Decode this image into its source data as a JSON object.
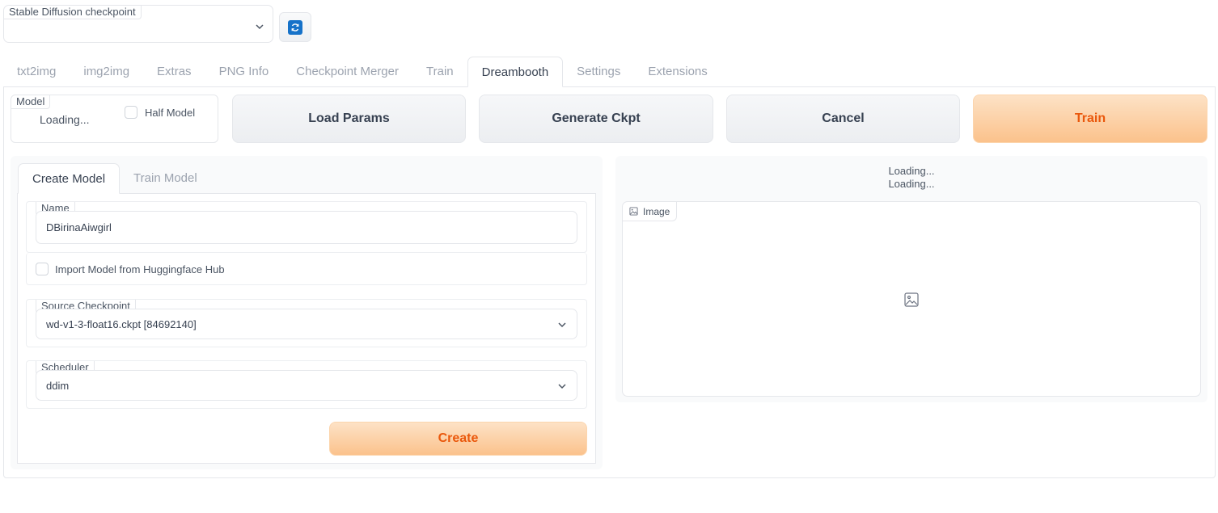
{
  "checkpoint": {
    "label": "Stable Diffusion checkpoint",
    "value": "",
    "refresh_icon": "refresh-icon"
  },
  "tabs": [
    {
      "label": "txt2img"
    },
    {
      "label": "img2img"
    },
    {
      "label": "Extras"
    },
    {
      "label": "PNG Info"
    },
    {
      "label": "Checkpoint Merger"
    },
    {
      "label": "Train"
    },
    {
      "label": "Dreambooth",
      "active": true
    },
    {
      "label": "Settings"
    },
    {
      "label": "Extensions"
    }
  ],
  "model": {
    "label": "Model",
    "loading": "Loading...",
    "half_model_label": "Half Model",
    "half_model_checked": false
  },
  "actions": {
    "load_params": "Load Params",
    "generate_ckpt": "Generate Ckpt",
    "cancel": "Cancel",
    "train": "Train"
  },
  "subtabs": [
    {
      "label": "Create Model",
      "active": true
    },
    {
      "label": "Train Model"
    }
  ],
  "create": {
    "name_label": "Name",
    "name_value": "DBirinaAiwgirl",
    "import_label": "Import Model from Huggingface Hub",
    "import_checked": false,
    "source_label": "Source Checkpoint",
    "source_value": "wd-v1-3-float16.ckpt [84692140]",
    "scheduler_label": "Scheduler",
    "scheduler_value": "ddim",
    "create_button": "Create"
  },
  "output": {
    "loading_1": "Loading...",
    "loading_2": "Loading...",
    "image_label": "Image"
  },
  "colors": {
    "accent": "#ea580c",
    "primary_bg": "#fbc28c",
    "refresh": "#1672c9"
  }
}
